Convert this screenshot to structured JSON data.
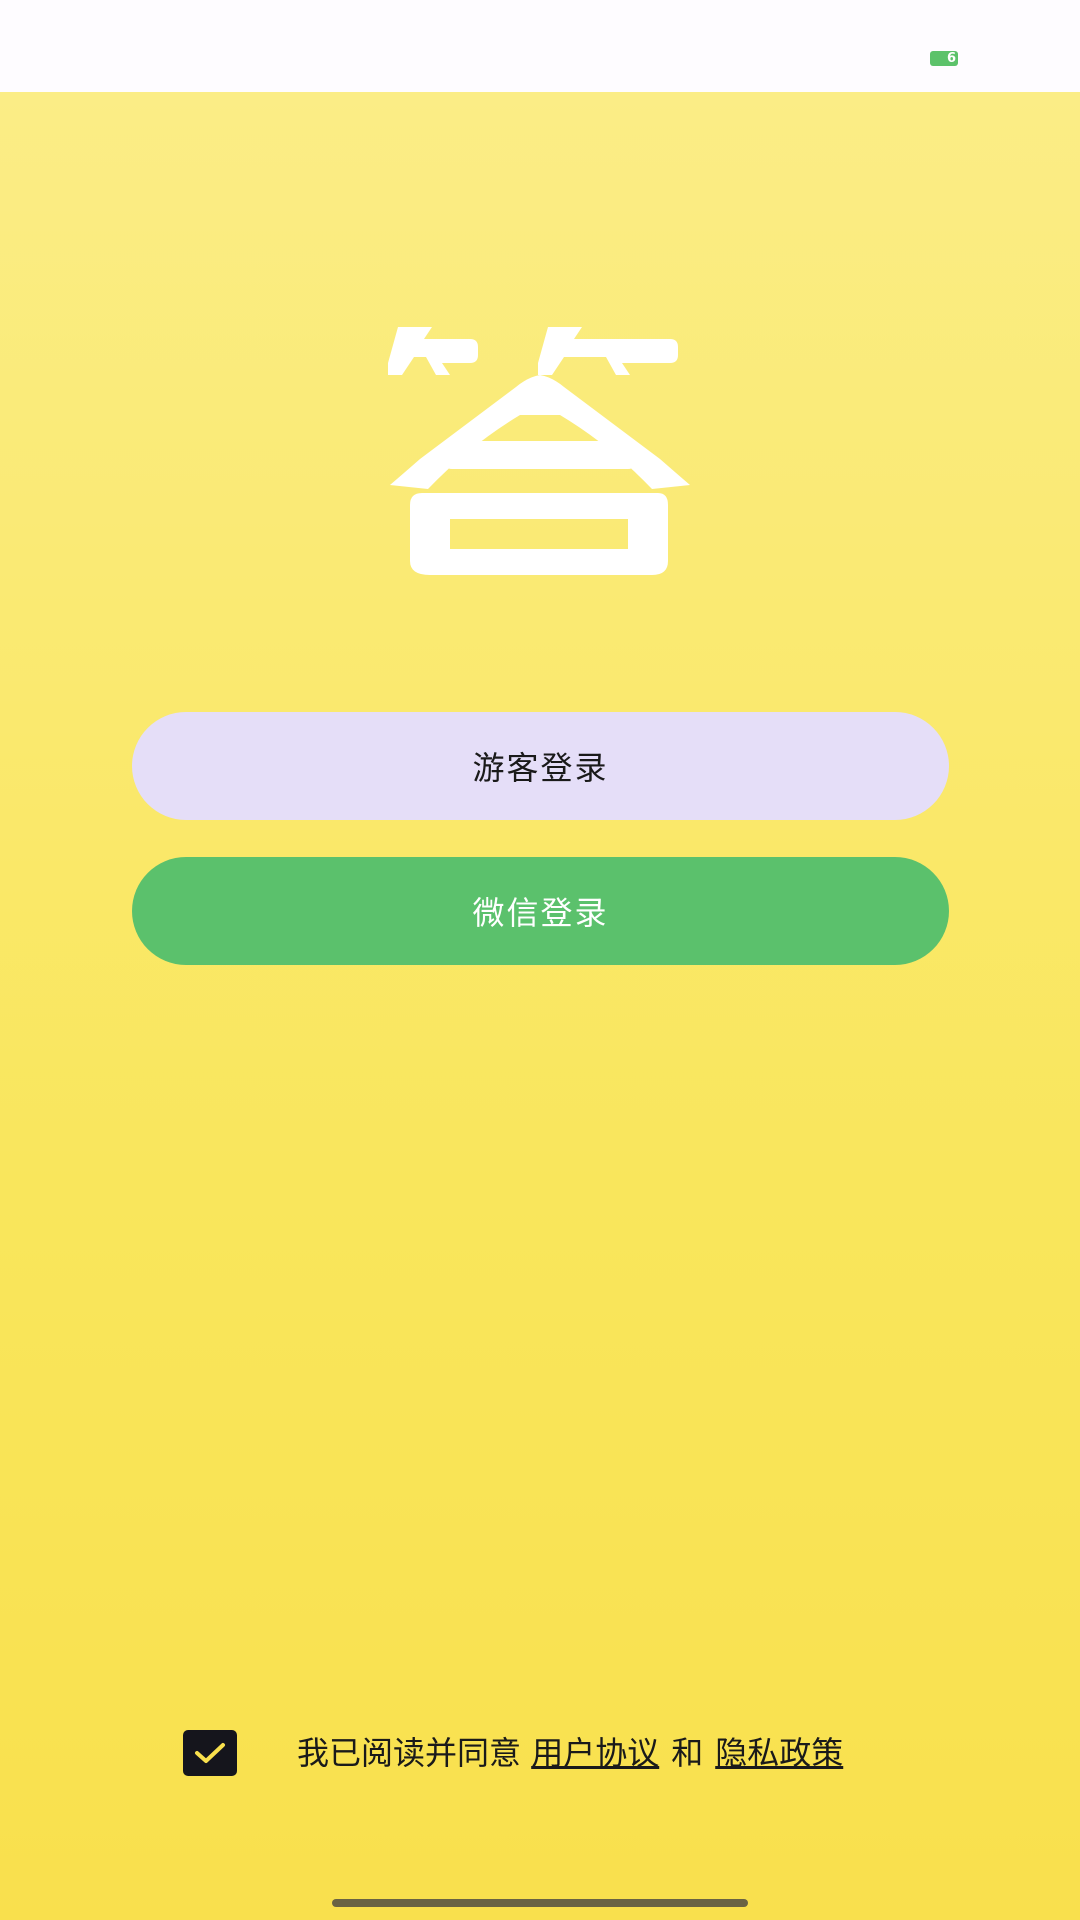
{
  "status_bar": {
    "battery_level": "6",
    "battery_color": "#5cc26a"
  },
  "logo": {
    "glyph_name": "answer-glyph-logo",
    "color": "#ffffff"
  },
  "buttons": {
    "guest_login": "游客登录",
    "wechat_login": "微信登录"
  },
  "agreement": {
    "checked": true,
    "prefix": "我已阅读并同意",
    "user_agreement": "用户协议",
    "conjunction": "和",
    "privacy_policy": "隐私政策"
  },
  "colors": {
    "background_top": "#fbed86",
    "background_bottom": "#f9e04d",
    "guest_button": "#e5def8",
    "wechat_button": "#5bc16c",
    "checkbox": "#15151c",
    "checkmark": "#f9e04d"
  }
}
